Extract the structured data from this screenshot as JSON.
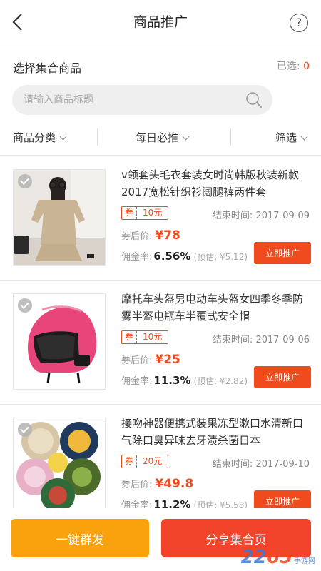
{
  "nav": {
    "title": "商品推广",
    "help": "?"
  },
  "section": {
    "label": "选择集合商品",
    "selected_prefix": "已选:",
    "selected_count": "0"
  },
  "search": {
    "placeholder": "请输入商品标题"
  },
  "filters": [
    {
      "label": "商品分类"
    },
    {
      "label": "每日必推"
    },
    {
      "label": "筛选"
    }
  ],
  "common": {
    "coupon_tag": "券",
    "end_prefix": "结束时间:",
    "price_label": "券后价:",
    "rate_label": "佣金率:",
    "promote_label": "立即推广"
  },
  "products": [
    {
      "name": "v领套头毛衣套装女时尚韩版秋装新款2017宽松针织衫阔腿裤两件套",
      "coupon": "10元",
      "end_date": "2017-09-09",
      "price": "¥78",
      "rate": "6.56%",
      "estimate": "(预估: ¥5.12)",
      "image": "woman-knit-sweater-photo"
    },
    {
      "name": "摩托车头盔男电动车头盔女四季冬季防雾半盔电瓶车半覆式安全帽",
      "coupon": "10元",
      "end_date": "2017-09-06",
      "price": "¥25",
      "rate": "11.3%",
      "estimate": "(预估: ¥2.82)",
      "image": "pink-helmet-photo"
    },
    {
      "name": "接吻神器便携式装果冻型漱口水清新口气除口臭异味去牙渍杀菌日本",
      "coupon": "20元",
      "end_date": "2017-09-10",
      "price": "¥49.8",
      "rate": "11.2%",
      "estimate": "(预估: ¥5.58)",
      "image": "mouthwash-pods-photo"
    }
  ],
  "bottom": {
    "left_label": "一键群发",
    "right_label": "分享集合页"
  },
  "watermark": {
    "brand_a": "22",
    "brand_b": "65",
    "suffix": "手游网"
  },
  "colors": {
    "accent": "#f04a1f",
    "orange": "#f9a20d",
    "red": "#f2432b"
  }
}
